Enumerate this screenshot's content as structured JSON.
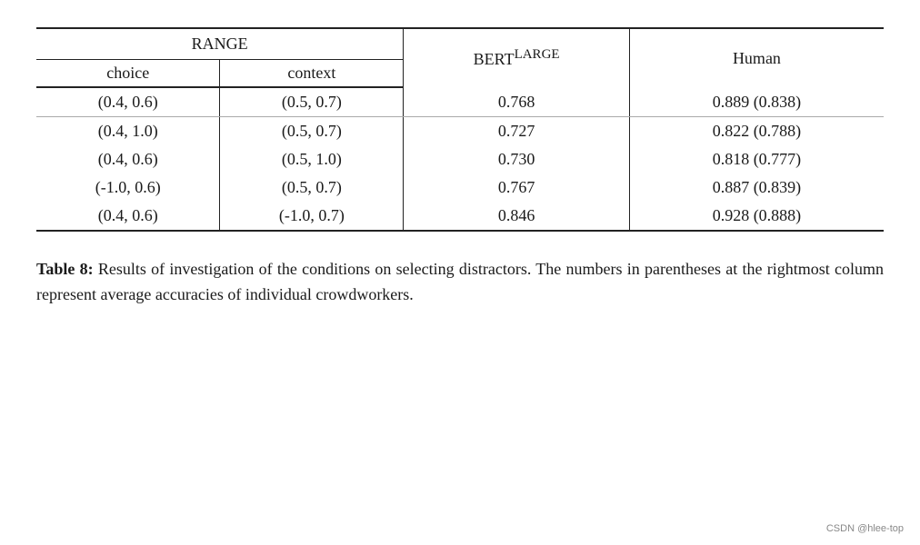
{
  "table": {
    "range_header": "RANGE",
    "col_choice_label": "choice",
    "col_context_label": "context",
    "col_bert_label": "BERT",
    "col_bert_sub": "LARGE",
    "col_human_label": "Human",
    "rows": [
      {
        "choice": "(0.4, 0.6)",
        "context": "(0.5, 0.7)",
        "bert": "0.768",
        "human": "0.889 (0.838)",
        "first": true
      },
      {
        "choice": "(0.4, 1.0)",
        "context": "(0.5, 0.7)",
        "bert": "0.727",
        "human": "0.822 (0.788)",
        "first": false
      },
      {
        "choice": "(0.4, 0.6)",
        "context": "(0.5, 1.0)",
        "bert": "0.730",
        "human": "0.818 (0.777)",
        "first": false
      },
      {
        "choice": "(-1.0, 0.6)",
        "context": "(0.5, 0.7)",
        "bert": "0.767",
        "human": "0.887 (0.839)",
        "first": false
      },
      {
        "choice": "(0.4, 0.6)",
        "context": "(-1.0, 0.7)",
        "bert": "0.846",
        "human": "0.928 (0.888)",
        "first": false
      }
    ]
  },
  "caption": {
    "label": "Table 8:",
    "text": " Results of investigation of the conditions on selecting distractors.  The numbers in parentheses at the rightmost column represent average accuracies of individual crowdworkers."
  },
  "watermark": "CSDN @hlee-top"
}
